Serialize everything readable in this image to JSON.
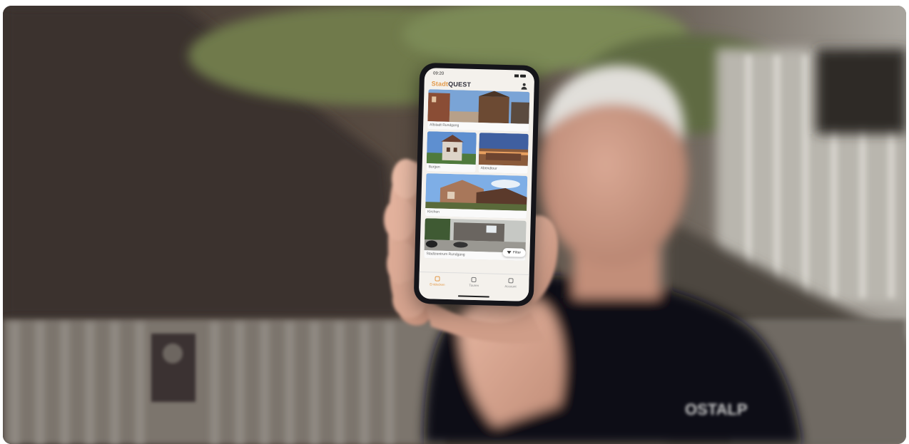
{
  "photo": {
    "scene": "person holding smartphone toward camera",
    "shirt_logo_text": "OSTALP"
  },
  "phone": {
    "status_time": "09:20",
    "app_logo_part1": "Stadt",
    "app_logo_part2": "QUEST",
    "tiles": [
      {
        "label": "Altstadt Rundgang"
      },
      {
        "label": "Burgen"
      },
      {
        "label": "Abendtour"
      },
      {
        "label": "Kirchen"
      },
      {
        "label": "Stadtzentrum Rundgang"
      }
    ],
    "filter_label": "Filter",
    "tabs": [
      {
        "label": "Entdecken",
        "icon": "compass-icon",
        "active": true
      },
      {
        "label": "Touren",
        "icon": "map-icon",
        "active": false
      },
      {
        "label": "Account",
        "icon": "user-icon",
        "active": false
      }
    ]
  },
  "colors": {
    "accent": "#e39a4a",
    "shirt": "#101014"
  }
}
